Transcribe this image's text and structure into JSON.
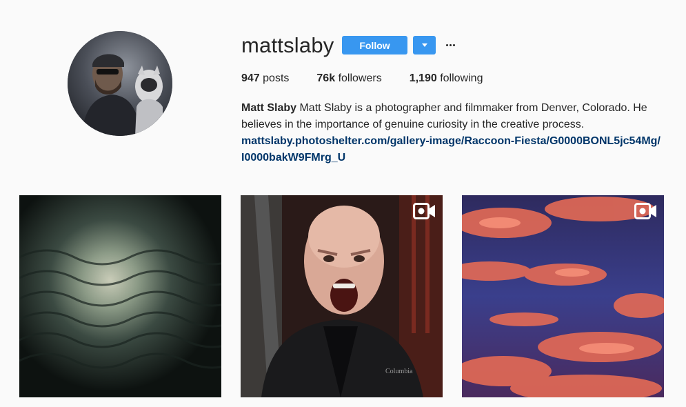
{
  "profile": {
    "username": "mattslaby",
    "follow_label": "Follow",
    "avatar_icon": "profile-photo",
    "more_icon": "ellipsis-icon",
    "dropdown_icon": "chevron-down-icon"
  },
  "stats": {
    "posts_count": "947",
    "posts_label": "posts",
    "followers_count": "76k",
    "followers_label": "followers",
    "following_count": "1,190",
    "following_label": "following"
  },
  "bio": {
    "full_name": "Matt Slaby",
    "text": "Matt Slaby is a photographer and filmmaker from Denver, Colorado. He believes in the importance of genuine curiosity in the creative process.",
    "link": "mattslaby.photoshelter.com/gallery-image/Raccoon-Fiesta/G0000BONL5jc54Mg/I0000bakW9FMrg_U"
  },
  "posts": [
    {
      "type": "photo",
      "description_icon": "image"
    },
    {
      "type": "video",
      "video_icon": "video-camera-icon",
      "overlay_text": "Columbia"
    },
    {
      "type": "video",
      "video_icon": "video-camera-icon"
    }
  ],
  "colors": {
    "accent": "#3897f0",
    "link": "#003569",
    "background": "#fafafa",
    "text": "#262626"
  }
}
